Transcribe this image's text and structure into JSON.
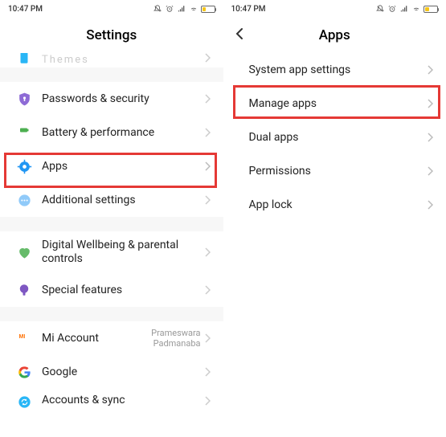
{
  "statusBar": {
    "time": "10:47 PM"
  },
  "left": {
    "title": "Settings",
    "items": {
      "themes": "Themes",
      "passwords": "Passwords & security",
      "battery": "Battery & performance",
      "apps": "Apps",
      "additional": "Additional settings",
      "wellbeing": "Digital Wellbeing & parental controls",
      "special": "Special features",
      "miaccount": "Mi Account",
      "miaccount_sub1": "Prameswara",
      "miaccount_sub2": "Padmanaba",
      "google": "Google",
      "accounts_sync": "Accounts & sync"
    }
  },
  "right": {
    "title": "Apps",
    "items": {
      "system": "System app settings",
      "manage": "Manage apps",
      "dual": "Dual apps",
      "permissions": "Permissions",
      "applock": "App lock"
    }
  },
  "colors": {
    "highlight": "#e53935",
    "iconBlue": "#2196f3",
    "iconGreen": "#4caf50",
    "iconPurple": "#7e57c2",
    "iconOrange": "#ff7043",
    "miOrange": "#ff6f00"
  }
}
